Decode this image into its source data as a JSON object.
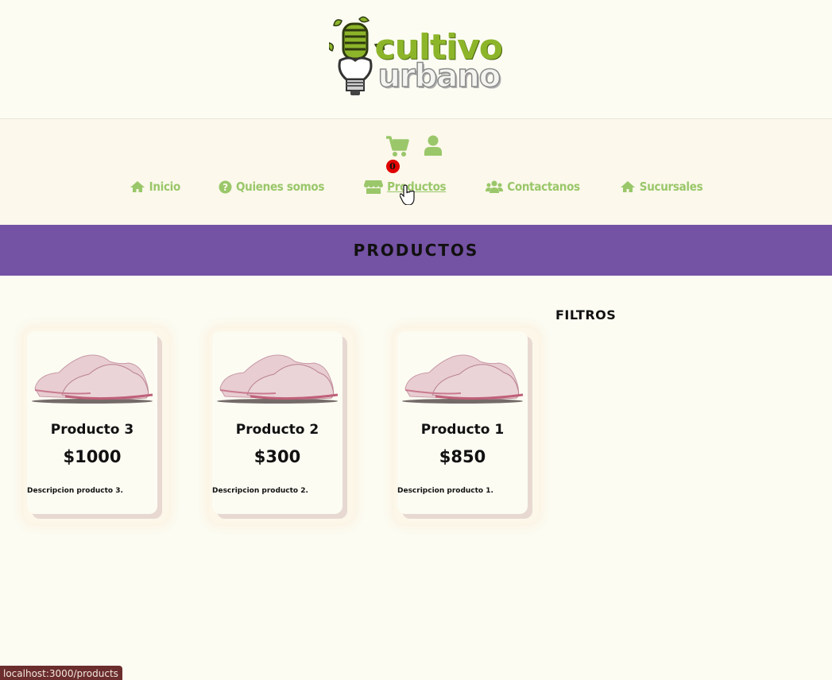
{
  "brand": {
    "word_top": "cultivo",
    "word_bottom": "urbano"
  },
  "cart": {
    "count": "0"
  },
  "nav": {
    "items": [
      {
        "label": "Inicio",
        "icon": "home-icon"
      },
      {
        "label": "Quienes somos",
        "icon": "question-circle-icon"
      },
      {
        "label": "Productos",
        "icon": "store-icon",
        "active": true
      },
      {
        "label": "Contactanos",
        "icon": "users-icon"
      },
      {
        "label": "Sucursales",
        "icon": "home-icon"
      }
    ]
  },
  "page": {
    "title": "PRODUCTOS",
    "filters_title": "FILTROS"
  },
  "products": [
    {
      "name": "Producto 3",
      "price": "$1000",
      "description": "Descripcion producto 3."
    },
    {
      "name": "Producto 2",
      "price": "$300",
      "description": "Descripcion producto 2."
    },
    {
      "name": "Producto 1",
      "price": "$850",
      "description": "Descripcion producto 1."
    }
  ],
  "status_bar": {
    "url": "localhost:3000/products"
  },
  "colors": {
    "accent_green": "#9ac76a",
    "banner_purple": "#7452a4",
    "badge_red": "#e10000"
  }
}
